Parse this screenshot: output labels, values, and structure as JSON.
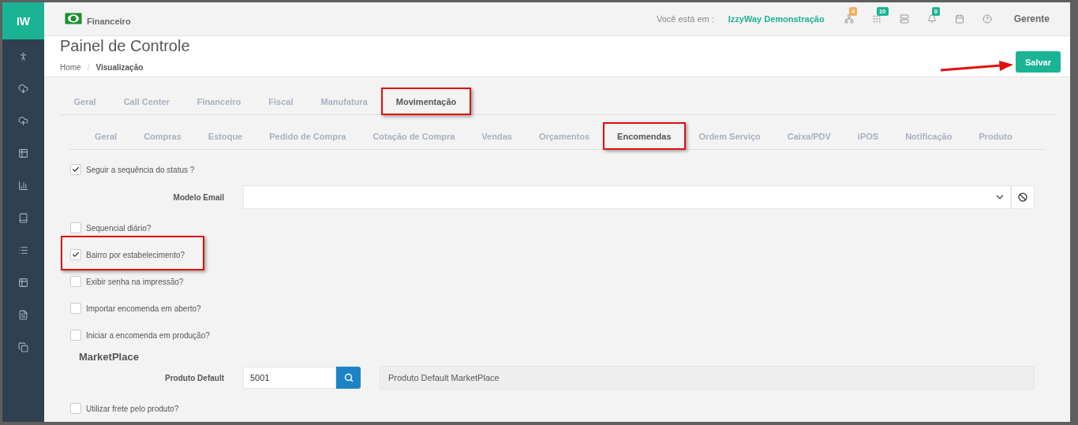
{
  "sidebar": {
    "logo": "IW"
  },
  "header": {
    "section": "Financeiro",
    "location_label": "Você está em :",
    "location": "IzzyWay Demonstração",
    "icons": [
      {
        "kind": "sitemap",
        "badge": "4",
        "color": "#f8ac59"
      },
      {
        "kind": "grid",
        "badge": "10",
        "color": "#1ab394"
      },
      {
        "kind": "server"
      },
      {
        "kind": "bell",
        "badge": "0",
        "color": "#1ab394"
      },
      {
        "kind": "calendar"
      },
      {
        "kind": "help"
      }
    ],
    "user": "Gerente"
  },
  "page": {
    "title": "Painel de Controle",
    "breadcrumb": [
      "Home",
      "Visualização"
    ],
    "breadcrumb_separator": "/",
    "save_button": "Salvar"
  },
  "tabs": [
    {
      "label": "Geral",
      "selected": false,
      "highlighted": false
    },
    {
      "label": "Call Center",
      "selected": false,
      "highlighted": false
    },
    {
      "label": "Financeiro",
      "selected": false,
      "highlighted": false
    },
    {
      "label": "Fiscal",
      "selected": false,
      "highlighted": false
    },
    {
      "label": "Manufatura",
      "selected": false,
      "highlighted": false
    },
    {
      "label": "Movimentação",
      "selected": true,
      "highlighted": true
    }
  ],
  "subtabs": [
    {
      "label": "Geral",
      "selected": false,
      "highlighted": false
    },
    {
      "label": "Compras",
      "selected": false,
      "highlighted": false
    },
    {
      "label": "Estoque",
      "selected": false,
      "highlighted": false
    },
    {
      "label": "Pedido de Compra",
      "selected": false,
      "highlighted": false
    },
    {
      "label": "Cotação de Compra",
      "selected": false,
      "highlighted": false
    },
    {
      "label": "Vendas",
      "selected": false,
      "highlighted": false
    },
    {
      "label": "Orçamentos",
      "selected": false,
      "highlighted": false
    },
    {
      "label": "Encomendas",
      "selected": true,
      "highlighted": true
    },
    {
      "label": "Ordem Serviço",
      "selected": false,
      "highlighted": false
    },
    {
      "label": "Caixa/PDV",
      "selected": false,
      "highlighted": false
    },
    {
      "label": "iPOS",
      "selected": false,
      "highlighted": false
    },
    {
      "label": "Notificação",
      "selected": false,
      "highlighted": false
    },
    {
      "label": "Produto",
      "selected": false,
      "highlighted": false
    }
  ],
  "form": [
    {
      "kind": "checkbox",
      "label": "Seguir a sequência do status ?",
      "checked": true,
      "highlighted": false
    },
    {
      "kind": "select",
      "label": "Modelo Email"
    },
    {
      "kind": "checkbox",
      "label": "Sequencial diário?",
      "checked": false,
      "highlighted": false
    },
    {
      "kind": "checkbox",
      "label": "Bairro por estabelecimento?",
      "checked": true,
      "highlighted": true
    },
    {
      "kind": "checkbox",
      "label": "Exibir senha na impressão?",
      "checked": false,
      "highlighted": false
    },
    {
      "kind": "checkbox",
      "label": "Importar encomenda em aberto?",
      "checked": false,
      "highlighted": false
    },
    {
      "kind": "checkbox",
      "label": "Iniciar a encomenda em produção?",
      "checked": false,
      "highlighted": false
    },
    {
      "kind": "heading",
      "label": "MarketPlace"
    },
    {
      "kind": "lookup",
      "label": "Produto Default",
      "value": "5001",
      "description": "Produto Default MarketPlace"
    },
    {
      "kind": "checkbox",
      "label": "Utilizar frete pelo produto?",
      "checked": false,
      "highlighted": false
    }
  ]
}
